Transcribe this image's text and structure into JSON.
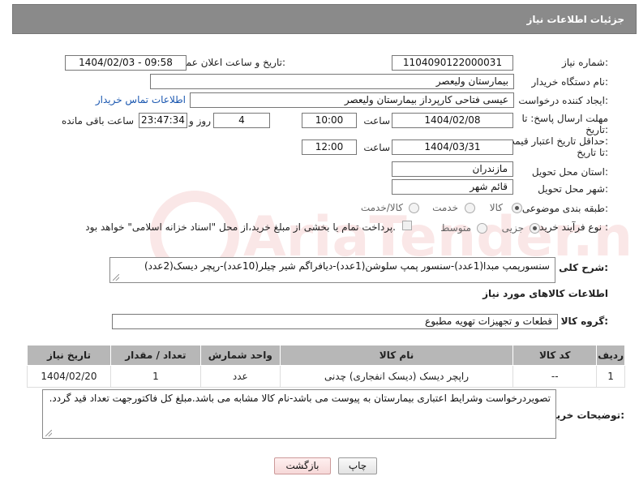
{
  "header": {
    "title": "جزئیات اطلاعات نیاز"
  },
  "form": {
    "need_number_label": "شماره نیاز:",
    "need_number": "1104090122000031",
    "announce_label": "تاریخ و ساعت اعلان عمومی:",
    "announce_value": "1404/02/03 - 09:58",
    "buyer_org_label": "نام دستگاه خریدار:",
    "buyer_org": "بیمارستان ولیعصر",
    "creator_label": "ایجاد کننده درخواست:",
    "creator": "عیسی فتاحی کارپرداز بیمارستان ولیعصر",
    "contact_link": "اطلاعات تماس خریدار",
    "reply_label_1": "مهلت ارسال پاسخ: تا",
    "reply_label_2": "تاریخ:",
    "reply_date": "1404/02/08",
    "time_label": "ساعت",
    "reply_time": "10:00",
    "days_value": "4",
    "days_label": "روز و",
    "remaining_value": "23:47:34",
    "remaining_label": "ساعت باقی مانده",
    "validity_label_1": "حداقل تاریخ اعتبار قیمت:",
    "validity_label_2": "تا تاریخ:",
    "validity_date": "1404/03/31",
    "validity_time": "12:00",
    "province_label": "استان محل تحویل:",
    "province": "مازندران",
    "city_label": "شهر محل تحویل:",
    "city": "قائم شهر",
    "category_label": "طبقه بندی موضوعی:",
    "category_options": [
      "کالا",
      "خدمت",
      "کالا/خدمت"
    ],
    "category_selected": "کالا",
    "process_label": "نوع فرآیند خرید :",
    "process_options": [
      "جزیی",
      "متوسط"
    ],
    "process_selected": "جزیی",
    "payment_note": "پرداخت تمام یا بخشی از مبلغ خرید،از محل \"اسناد خزانه اسلامی\" خواهد بود."
  },
  "description": {
    "label": "شرح کلی نیاز:",
    "text": "سنسورپمپ مبدا(1عدد)-سنسور پمپ سلوشن(1عدد)-دیافراگم شیر چیلر(10عدد)-رپچر دیسک(2عدد)"
  },
  "goods": {
    "section_title": "اطلاعات کالاهای مورد نیاز",
    "group_label": "گروه کالا:",
    "group_value": "قطعات و تجهیزات تهویه مطبوع",
    "columns": [
      "ردیف",
      "کد کالا",
      "نام کالا",
      "واحد شمارش",
      "تعداد / مقدار",
      "تاریخ نیاز"
    ],
    "rows": [
      [
        "1",
        "--",
        "راپچر دیسک (دیسک انفجاری) چدنی",
        "عدد",
        "1",
        "1404/02/20"
      ]
    ]
  },
  "buyer_notes": {
    "label": "توضیحات خریدار:",
    "text": "تصویردرخواست وشرایط اعتباری بیمارستان به پیوست می باشد-نام کالا مشابه می باشد.مبلغ کل فاکتورجهت تعداد قید گردد."
  },
  "buttons": {
    "print": "چاپ",
    "back": "بازگشت"
  },
  "watermark": {
    "text": "AriaTender.neT"
  },
  "colors": {
    "header_bg": "#8a8a8a",
    "table_header_bg": "#b7b7b7",
    "link": "#1a57b0"
  }
}
